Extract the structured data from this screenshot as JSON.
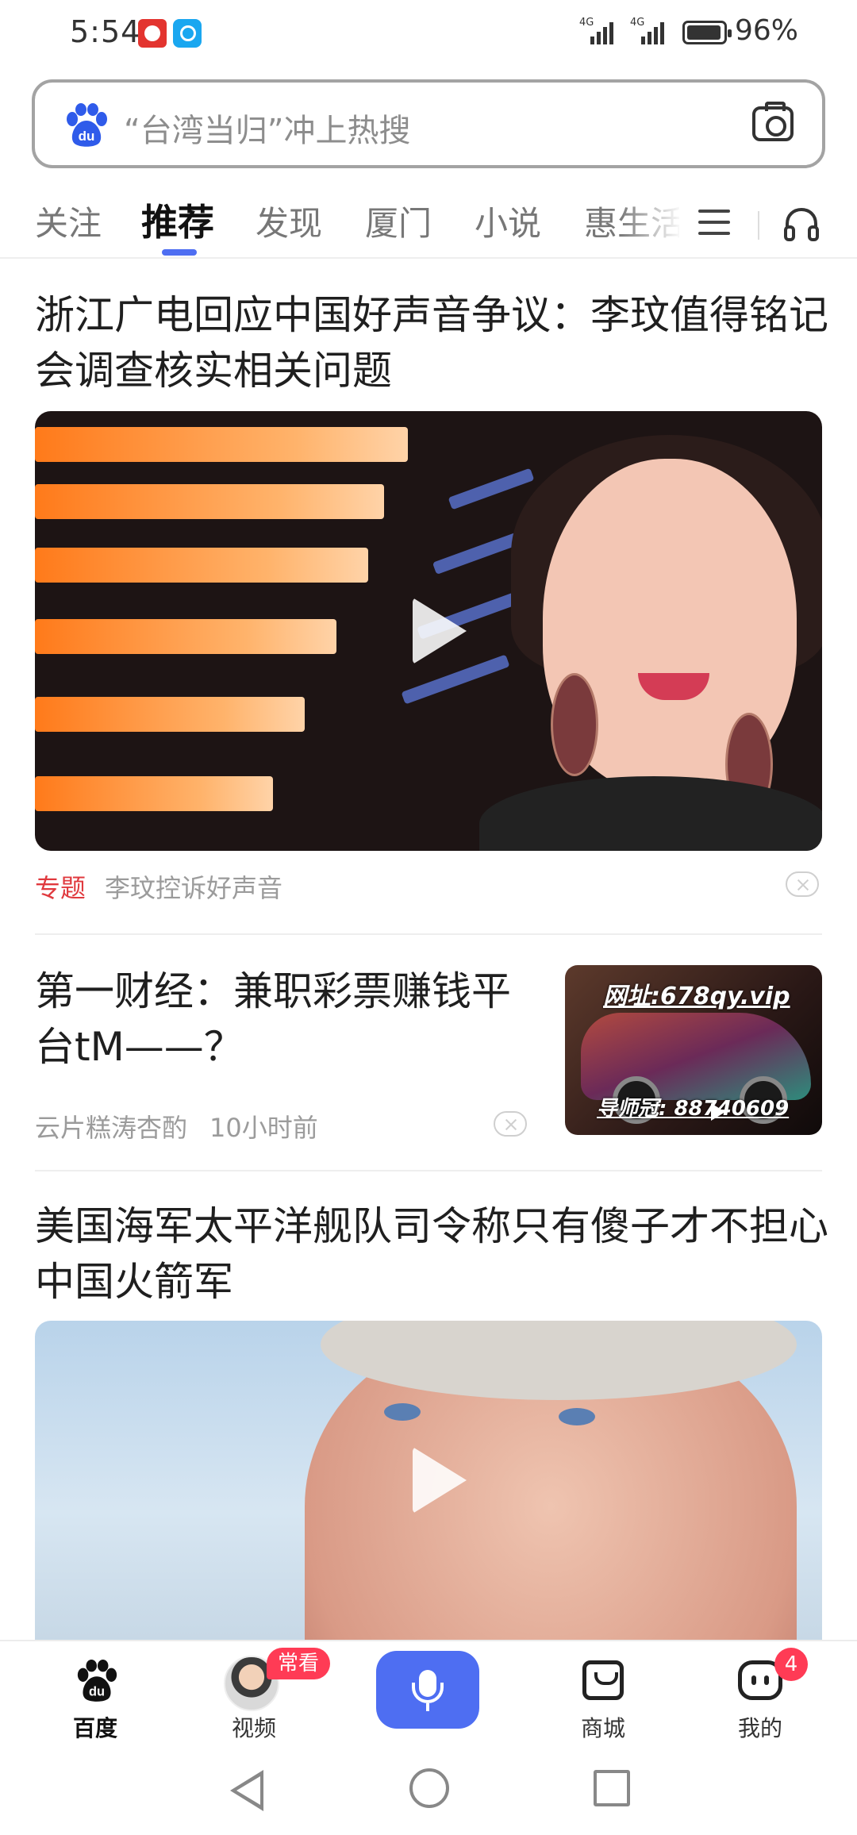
{
  "status_bar": {
    "time": "5:54",
    "signal1_label": "4G",
    "signal2_label": "4G",
    "battery_percent": "96%"
  },
  "search": {
    "placeholder": "“台湾当归”冲上热搜",
    "logo_text": "du"
  },
  "tabs": [
    {
      "label": "关注",
      "active": false
    },
    {
      "label": "推荐",
      "active": true
    },
    {
      "label": "发现",
      "active": false
    },
    {
      "label": "厦门",
      "active": false
    },
    {
      "label": "小说",
      "active": false
    },
    {
      "label": "惠生活",
      "active": false
    }
  ],
  "feed": [
    {
      "type": "video",
      "title": "浙江广电回应中国好声音争议：李玟值得铭记 会调查核实相关问题",
      "tag": "专题",
      "subtitle": "李玟控诉好声音"
    },
    {
      "type": "article",
      "title": "第一财经：兼职彩票赚钱平台tM——？",
      "source": "云片糕涛杏酌",
      "time": "10小时前",
      "thumb_text_top": "网址:678qy.vip",
      "thumb_text_bottom": "导师冠: 88740609"
    },
    {
      "type": "video",
      "title": "美国海军太平洋舰队司令称只有傻子才不担心中国火箭军"
    }
  ],
  "bottom_nav": {
    "home_label": "百度",
    "video_label": "视频",
    "video_badge": "常看",
    "mall_label": "商城",
    "me_label": "我的",
    "me_badge": "4"
  },
  "colors": {
    "accent": "#4e6ef2",
    "badge_red": "#ff3b55",
    "tag_red": "#e0393e"
  }
}
